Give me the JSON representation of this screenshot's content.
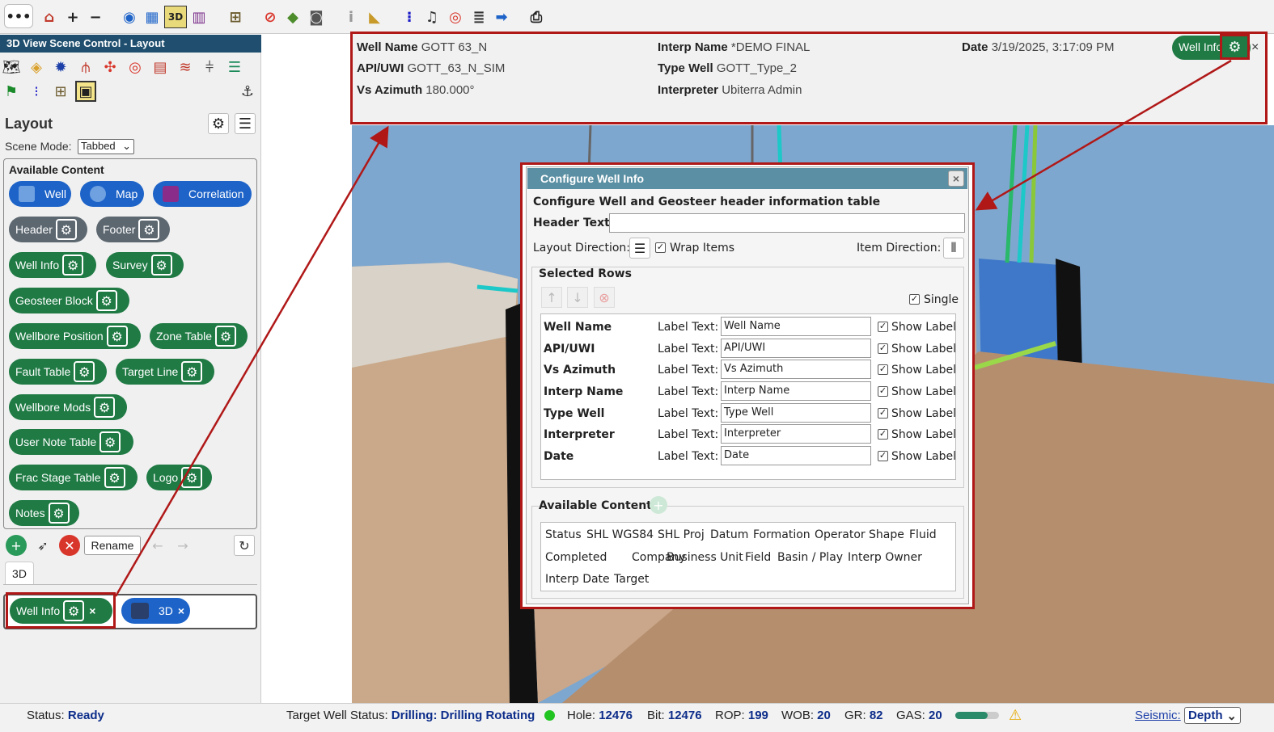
{
  "toolbar": {
    "more_label": "•••",
    "icons": [
      "home-icon",
      "zoom-in-icon",
      "zoom-out-icon",
      "compass-icon",
      "grid-icon",
      "3d-icon",
      "correlation-icon",
      "layout-icon",
      "no-compass-icon",
      "cube-icon",
      "camera-icon",
      "info-icon",
      "measure-icon",
      "survey-points-icon",
      "alarm-icon",
      "target-icon",
      "layers-icon",
      "arrow-right-icon",
      "print-icon"
    ]
  },
  "left_panel": {
    "title": "3D View Scene Control - Layout",
    "layout_label": "Layout",
    "scene_mode_label": "Scene Mode:",
    "scene_mode_value": "Tabbed",
    "available_content_title": "Available Content",
    "view_buttons": [
      {
        "label": "Well",
        "color": "#1d63c8"
      },
      {
        "label": "Map",
        "color": "#1d63c8"
      },
      {
        "label": "Correlation",
        "color": "#1d63c8"
      }
    ],
    "content_items": [
      {
        "label": "Header"
      },
      {
        "label": "Footer"
      },
      {
        "label": "Well Info"
      },
      {
        "label": "Survey"
      },
      {
        "label": "Geosteer Block"
      },
      {
        "label": "Wellbore Position"
      },
      {
        "label": "Zone Table"
      },
      {
        "label": "Fault Table"
      },
      {
        "label": "Target Line"
      },
      {
        "label": "Wellbore Mods"
      },
      {
        "label": "User Note Table"
      },
      {
        "label": "Frac Stage Table"
      },
      {
        "label": "Logo"
      },
      {
        "label": "Notes"
      }
    ],
    "rename_label": "Rename",
    "tab_label": "3D",
    "scene_items": [
      {
        "label": "Well Info"
      },
      {
        "label": "3D"
      }
    ]
  },
  "header_info": {
    "well_name_label": "Well Name",
    "well_name_value": "GOTT 63_N",
    "api_label": "API/UWI",
    "api_value": "GOTT_63_N_SIM",
    "vs_label": "Vs Azimuth",
    "vs_value": "180.000°",
    "interp_name_label": "Interp Name",
    "interp_name_value": "*DEMO FINAL",
    "type_well_label": "Type Well",
    "type_well_value": "GOTT_Type_2",
    "interpreter_label": "Interpreter",
    "interpreter_value": "Ubiterra Admin",
    "date_label": "Date",
    "date_value": "3/19/2025, 3:17:09 PM",
    "pill_label": "Well Info"
  },
  "dialog": {
    "title": "Configure Well Info",
    "subtitle": "Configure Well and Geosteer header information table",
    "header_text_label": "Header Text",
    "header_text_value": "",
    "layout_direction_label": "Layout Direction:",
    "wrap_items_label": "Wrap Items",
    "item_direction_label": "Item Direction:",
    "selected_rows_title": "Selected Rows",
    "single_label": "Single",
    "label_text_caption": "Label Text:",
    "show_label_caption": "Show Label",
    "rows": [
      {
        "name": "Well Name",
        "label_text": "Well Name"
      },
      {
        "name": "API/UWI",
        "label_text": "API/UWI"
      },
      {
        "name": "Vs Azimuth",
        "label_text": "Vs Azimuth"
      },
      {
        "name": "Interp Name",
        "label_text": "Interp Name"
      },
      {
        "name": "Type Well",
        "label_text": "Type Well"
      },
      {
        "name": "Interpreter",
        "label_text": "Interpreter"
      },
      {
        "name": "Date",
        "label_text": "Date"
      }
    ],
    "available_content_title": "Available Content",
    "available_items": [
      "Status",
      "SHL WGS84",
      "SHL Proj",
      "Datum",
      "Formation",
      "Operator",
      "Shape",
      "Fluid",
      "Completed",
      "Company",
      "Business Unit",
      "Field",
      "Basin / Play",
      "Interp Owner",
      "Interp Date",
      "Target"
    ]
  },
  "status_bar": {
    "status_label": "Status:",
    "status_value": "Ready",
    "target_label": "Target Well Status:",
    "target_value": "Drilling: Drilling Rotating",
    "hole_label": "Hole:",
    "hole_value": "12476",
    "bit_label": "Bit:",
    "bit_value": "12476",
    "rop_label": "ROP:",
    "rop_value": "199",
    "wob_label": "WOB:",
    "wob_value": "20",
    "gr_label": "GR:",
    "gr_value": "82",
    "gas_label": "GAS:",
    "gas_value": "20",
    "seismic_label": "Seismic:",
    "seismic_value": "Depth"
  },
  "colors": {
    "accent_green": "#1f7a44",
    "highlight_red": "#b01818",
    "status_blue": "#0d2d8a",
    "panel_header": "#1f4e6e"
  }
}
